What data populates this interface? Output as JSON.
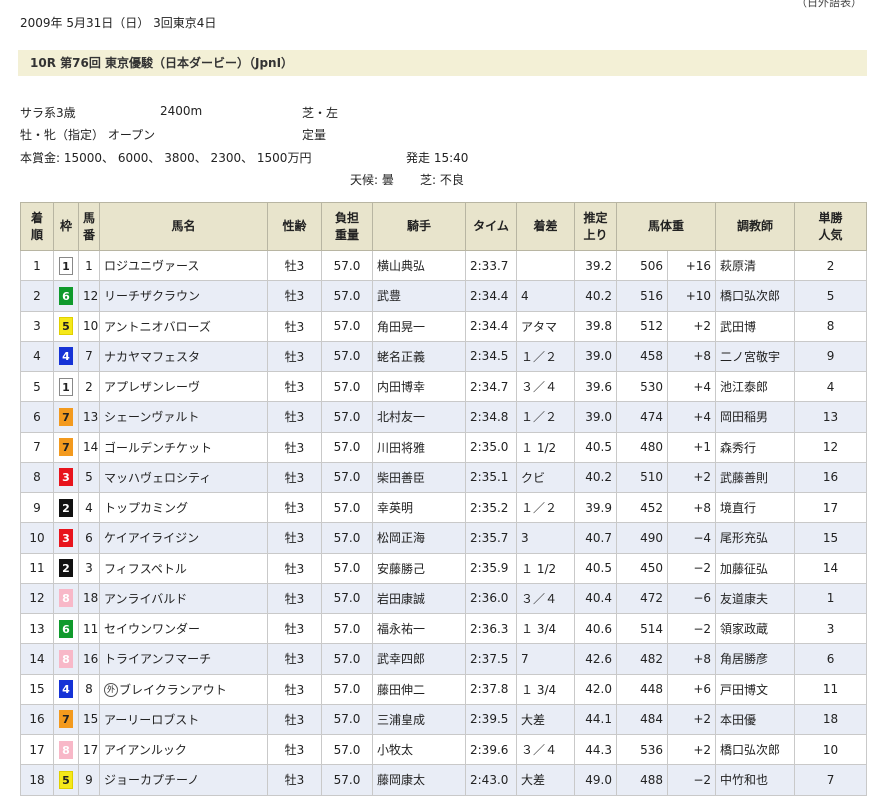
{
  "top_right": "（日外語表）",
  "date": "2009年 5月31日（日） 3回東京4日",
  "race_title": "10R 第76回 東京優駿（日本ダービー）（JpnI）",
  "info": {
    "class": "サラ系3歳",
    "distance": "2400m",
    "surface": "芝・左",
    "condition": "牡・牝（指定） オープン",
    "weight_rule": "定量",
    "prize": "本賞金: 15000、 6000、 3800、 2300、 1500万円",
    "start": "発走 15:40",
    "weather": "天候: 曇",
    "going": "芝: 不良"
  },
  "headers": {
    "rank_1": "着",
    "rank_2": "順",
    "waku": "枠",
    "num_1": "馬",
    "num_2": "番",
    "horse": "馬名",
    "age": "性齢",
    "wt_1": "負担",
    "wt_2": "重量",
    "jockey": "騎手",
    "time": "タイム",
    "margin": "着差",
    "last_1": "推定",
    "last_2": "上り",
    "body": "馬体重",
    "trainer": "調教師",
    "pop_1": "単勝",
    "pop_2": "人気"
  },
  "waku_colors": {
    "1": {
      "bg": "#ffffff",
      "fg": "#222222",
      "border": "#888888"
    },
    "2": {
      "bg": "#111111",
      "fg": "#ffffff",
      "border": "#111111"
    },
    "3": {
      "bg": "#e8141c",
      "fg": "#ffffff",
      "border": "#e8141c"
    },
    "4": {
      "bg": "#1633d6",
      "fg": "#ffffff",
      "border": "#1633d6"
    },
    "5": {
      "bg": "#f5e81a",
      "fg": "#222222",
      "border": "#e0d000"
    },
    "6": {
      "bg": "#109a2c",
      "fg": "#ffffff",
      "border": "#109a2c"
    },
    "7": {
      "bg": "#f39a1e",
      "fg": "#222222",
      "border": "#f39a1e"
    },
    "8": {
      "bg": "#f8b8c8",
      "fg": "#ffffff",
      "border": "#f8b8c8"
    }
  },
  "rows": [
    {
      "rank": "1",
      "waku": "1",
      "num": "1",
      "mark": "",
      "horse": "ロジユニヴァース",
      "age": "牡3",
      "weight": "57.0",
      "jockey": "横山典弘",
      "time": "2:33.7",
      "margin": "",
      "last": "39.2",
      "body": "506",
      "diff": "+16",
      "trainer": "萩原清",
      "pop": "2"
    },
    {
      "rank": "2",
      "waku": "6",
      "num": "12",
      "mark": "",
      "horse": "リーチザクラウン",
      "age": "牡3",
      "weight": "57.0",
      "jockey": "武豊",
      "time": "2:34.4",
      "margin": "4",
      "last": "40.2",
      "body": "516",
      "diff": "+10",
      "trainer": "橋口弘次郎",
      "pop": "5"
    },
    {
      "rank": "3",
      "waku": "5",
      "num": "10",
      "mark": "",
      "horse": "アントニオバローズ",
      "age": "牡3",
      "weight": "57.0",
      "jockey": "角田晃一",
      "time": "2:34.4",
      "margin": "アタマ",
      "last": "39.8",
      "body": "512",
      "diff": "+2",
      "trainer": "武田博",
      "pop": "8"
    },
    {
      "rank": "4",
      "waku": "4",
      "num": "7",
      "mark": "",
      "horse": "ナカヤマフェスタ",
      "age": "牡3",
      "weight": "57.0",
      "jockey": "蛯名正義",
      "time": "2:34.5",
      "margin": "１／２",
      "last": "39.0",
      "body": "458",
      "diff": "+8",
      "trainer": "二ノ宮敬宇",
      "pop": "9"
    },
    {
      "rank": "5",
      "waku": "1",
      "num": "2",
      "mark": "",
      "horse": "アプレザンレーヴ",
      "age": "牡3",
      "weight": "57.0",
      "jockey": "内田博幸",
      "time": "2:34.7",
      "margin": "３／４",
      "last": "39.6",
      "body": "530",
      "diff": "+4",
      "trainer": "池江泰郎",
      "pop": "4"
    },
    {
      "rank": "6",
      "waku": "7",
      "num": "13",
      "mark": "",
      "horse": "シェーンヴァルト",
      "age": "牡3",
      "weight": "57.0",
      "jockey": "北村友一",
      "time": "2:34.8",
      "margin": "１／２",
      "last": "39.0",
      "body": "474",
      "diff": "+4",
      "trainer": "岡田稲男",
      "pop": "13"
    },
    {
      "rank": "7",
      "waku": "7",
      "num": "14",
      "mark": "",
      "horse": "ゴールデンチケット",
      "age": "牡3",
      "weight": "57.0",
      "jockey": "川田将雅",
      "time": "2:35.0",
      "margin": "１ 1/2",
      "last": "40.5",
      "body": "480",
      "diff": "+1",
      "trainer": "森秀行",
      "pop": "12"
    },
    {
      "rank": "8",
      "waku": "3",
      "num": "5",
      "mark": "",
      "horse": "マッハヴェロシティ",
      "age": "牡3",
      "weight": "57.0",
      "jockey": "柴田善臣",
      "time": "2:35.1",
      "margin": "クビ",
      "last": "40.2",
      "body": "510",
      "diff": "+2",
      "trainer": "武藤善則",
      "pop": "16"
    },
    {
      "rank": "9",
      "waku": "2",
      "num": "4",
      "mark": "",
      "horse": "トップカミング",
      "age": "牡3",
      "weight": "57.0",
      "jockey": "幸英明",
      "time": "2:35.2",
      "margin": "１／２",
      "last": "39.9",
      "body": "452",
      "diff": "+8",
      "trainer": "境直行",
      "pop": "17"
    },
    {
      "rank": "10",
      "waku": "3",
      "num": "6",
      "mark": "",
      "horse": "ケイアイライジン",
      "age": "牡3",
      "weight": "57.0",
      "jockey": "松岡正海",
      "time": "2:35.7",
      "margin": "3",
      "last": "40.7",
      "body": "490",
      "diff": "−4",
      "trainer": "尾形充弘",
      "pop": "15"
    },
    {
      "rank": "11",
      "waku": "2",
      "num": "3",
      "mark": "",
      "horse": "フィフスペトル",
      "age": "牡3",
      "weight": "57.0",
      "jockey": "安藤勝己",
      "time": "2:35.9",
      "margin": "１ 1/2",
      "last": "40.5",
      "body": "450",
      "diff": "−2",
      "trainer": "加藤征弘",
      "pop": "14"
    },
    {
      "rank": "12",
      "waku": "8",
      "num": "18",
      "mark": "",
      "horse": "アンライバルド",
      "age": "牡3",
      "weight": "57.0",
      "jockey": "岩田康誠",
      "time": "2:36.0",
      "margin": "３／４",
      "last": "40.4",
      "body": "472",
      "diff": "−6",
      "trainer": "友道康夫",
      "pop": "1"
    },
    {
      "rank": "13",
      "waku": "6",
      "num": "11",
      "mark": "",
      "horse": "セイウンワンダー",
      "age": "牡3",
      "weight": "57.0",
      "jockey": "福永祐一",
      "time": "2:36.3",
      "margin": "１ 3/4",
      "last": "40.6",
      "body": "514",
      "diff": "−2",
      "trainer": "領家政蔵",
      "pop": "3"
    },
    {
      "rank": "14",
      "waku": "8",
      "num": "16",
      "mark": "",
      "horse": "トライアンフマーチ",
      "age": "牡3",
      "weight": "57.0",
      "jockey": "武幸四郎",
      "time": "2:37.5",
      "margin": "7",
      "last": "42.6",
      "body": "482",
      "diff": "+8",
      "trainer": "角居勝彦",
      "pop": "6"
    },
    {
      "rank": "15",
      "waku": "4",
      "num": "8",
      "mark": "外",
      "horse": "ブレイクランアウト",
      "age": "牡3",
      "weight": "57.0",
      "jockey": "藤田伸二",
      "time": "2:37.8",
      "margin": "１ 3/4",
      "last": "42.0",
      "body": "448",
      "diff": "+6",
      "trainer": "戸田博文",
      "pop": "11"
    },
    {
      "rank": "16",
      "waku": "7",
      "num": "15",
      "mark": "",
      "horse": "アーリーロブスト",
      "age": "牡3",
      "weight": "57.0",
      "jockey": "三浦皇成",
      "time": "2:39.5",
      "margin": "大差",
      "last": "44.1",
      "body": "484",
      "diff": "+2",
      "trainer": "本田優",
      "pop": "18"
    },
    {
      "rank": "17",
      "waku": "8",
      "num": "17",
      "mark": "",
      "horse": "アイアンルック",
      "age": "牡3",
      "weight": "57.0",
      "jockey": "小牧太",
      "time": "2:39.6",
      "margin": "３／４",
      "last": "44.3",
      "body": "536",
      "diff": "+2",
      "trainer": "橋口弘次郎",
      "pop": "10"
    },
    {
      "rank": "18",
      "waku": "5",
      "num": "9",
      "mark": "",
      "horse": "ジョーカプチーノ",
      "age": "牡3",
      "weight": "57.0",
      "jockey": "藤岡康太",
      "time": "2:43.0",
      "margin": "大差",
      "last": "49.0",
      "body": "488",
      "diff": "−2",
      "trainer": "中竹和也",
      "pop": "7"
    }
  ]
}
